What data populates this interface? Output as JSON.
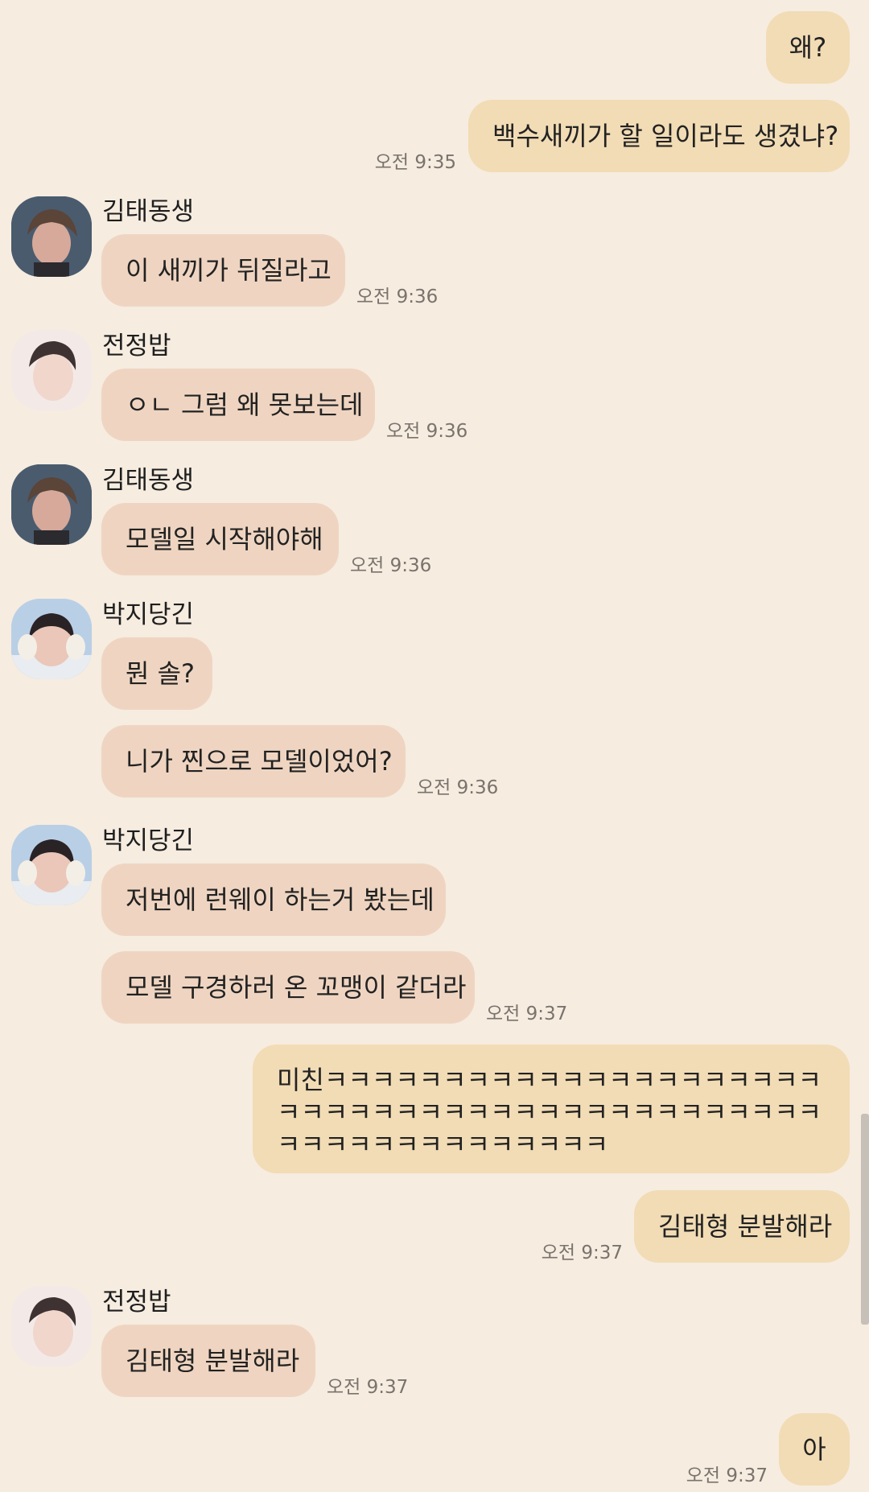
{
  "messages": [
    {
      "text": "왜?"
    },
    {
      "text": "백수새끼가 할 일이라도 생겼냐?",
      "time": "오전 9:35"
    },
    {
      "sender": "김태동생",
      "text": "이 새끼가 뒤질라고",
      "time": "오전 9:36"
    },
    {
      "sender": "전정밥",
      "text": "ㅇㄴ 그럼 왜 못보는데",
      "time": "오전 9:36"
    },
    {
      "sender": "김태동생",
      "text": "모델일 시작해야해",
      "time": "오전 9:36"
    },
    {
      "sender": "박지당긴",
      "text": "뭔 솔?"
    },
    {
      "text": "니가 찐으로 모델이었어?",
      "time": "오전 9:36"
    },
    {
      "sender": "박지당긴",
      "text": "저번에 런웨이 하는거 봤는데"
    },
    {
      "text": "모델 구경하러 온 꼬맹이 같더라",
      "time": "오전 9:37"
    },
    {
      "text": "미친ㅋㅋㅋㅋㅋㅋㅋㅋㅋㅋㅋㅋㅋㅋㅋㅋㅋㅋㅋㅋㅋㅋㅋㅋㅋㅋㅋㅋㅋㅋㅋㅋㅋㅋㅋㅋㅋㅋㅋㅋㅋㅋㅋㅋㅋㅋㅋㅋㅋㅋㅋㅋㅋㅋㅋㅋㅋㅋ"
    },
    {
      "text": "김태형 분발해라",
      "time": "오전 9:37"
    },
    {
      "sender": "전정밥",
      "text": "김태형 분발해라",
      "time": "오전 9:37"
    },
    {
      "text": "아",
      "time": "오전 9:37"
    }
  ],
  "icons": {
    "avatar_kim": "person-photo-icon",
    "avatar_jeon": "person-photo-icon",
    "avatar_park": "person-photo-icon"
  },
  "colors": {
    "background": "#f6ece0",
    "my_bubble": "#f2dcb5",
    "their_bubble": "#efd5c1",
    "timestamp": "#7a736c"
  }
}
